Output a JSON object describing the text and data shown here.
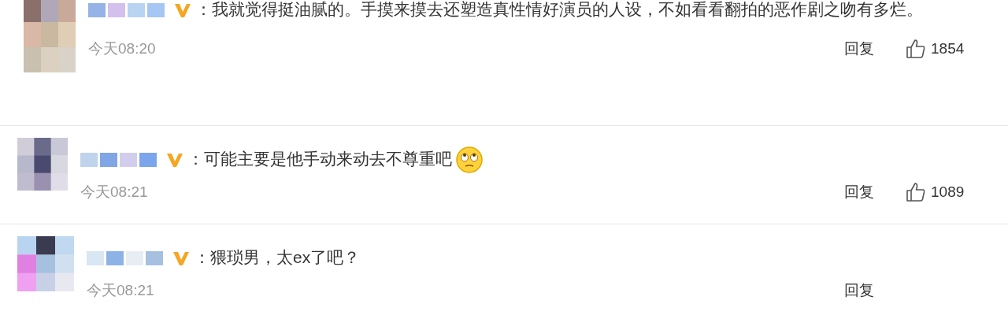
{
  "comments": [
    {
      "text": "：我就觉得挺油腻的。手摸来摸去还塑造真性情好演员的人设，不如看看翻拍的恶作剧之吻有多烂。",
      "emoji": false,
      "time": "今天08:20",
      "reply": "回复",
      "likes": "1854"
    },
    {
      "text": "：可能主要是他手动来动去不尊重吧",
      "emoji": true,
      "time": "今天08:21",
      "reply": "回复",
      "likes": "1089"
    },
    {
      "text": "：猥琐男，太ex了吧？",
      "emoji": false,
      "time": "今天08:21",
      "reply": "回复"
    }
  ]
}
